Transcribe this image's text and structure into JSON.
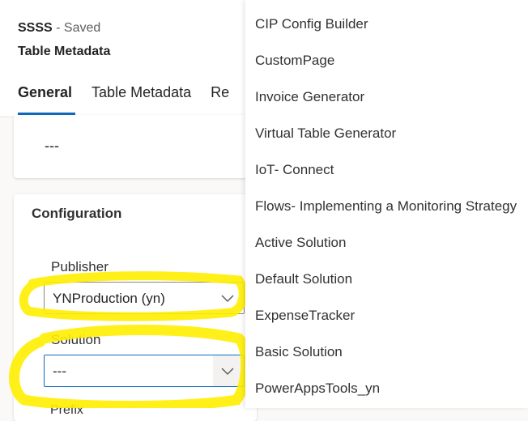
{
  "header": {
    "entity_name": "SSSS",
    "save_status": "- Saved",
    "subtitle": "Table Metadata",
    "tabs": [
      {
        "label": "General",
        "active": true
      },
      {
        "label": "Table Metadata",
        "active": false
      },
      {
        "label": "Re",
        "active": false
      }
    ]
  },
  "top_card": {
    "value": "---"
  },
  "configuration": {
    "title": "Configuration",
    "publisher": {
      "label": "Publisher",
      "value": "YNProduction (yn)"
    },
    "solution": {
      "label": "Solution",
      "value": "---"
    },
    "next_label_partial": "Prefix"
  },
  "dropdown": {
    "items": [
      "CIP Config Builder",
      "CustomPage",
      "Invoice Generator",
      "Virtual Table Generator",
      "IoT- Connect",
      "Flows- Implementing a Monitoring Strategy",
      "Active Solution",
      "Default Solution",
      "ExpenseTracker",
      "Basic Solution",
      "PowerAppsTools_yn"
    ]
  },
  "colors": {
    "accent": "#0f6cbd",
    "highlight": "#ffee00",
    "background": "#faf9f8"
  },
  "icons": {
    "select_chevron": "chevron-down-icon"
  }
}
